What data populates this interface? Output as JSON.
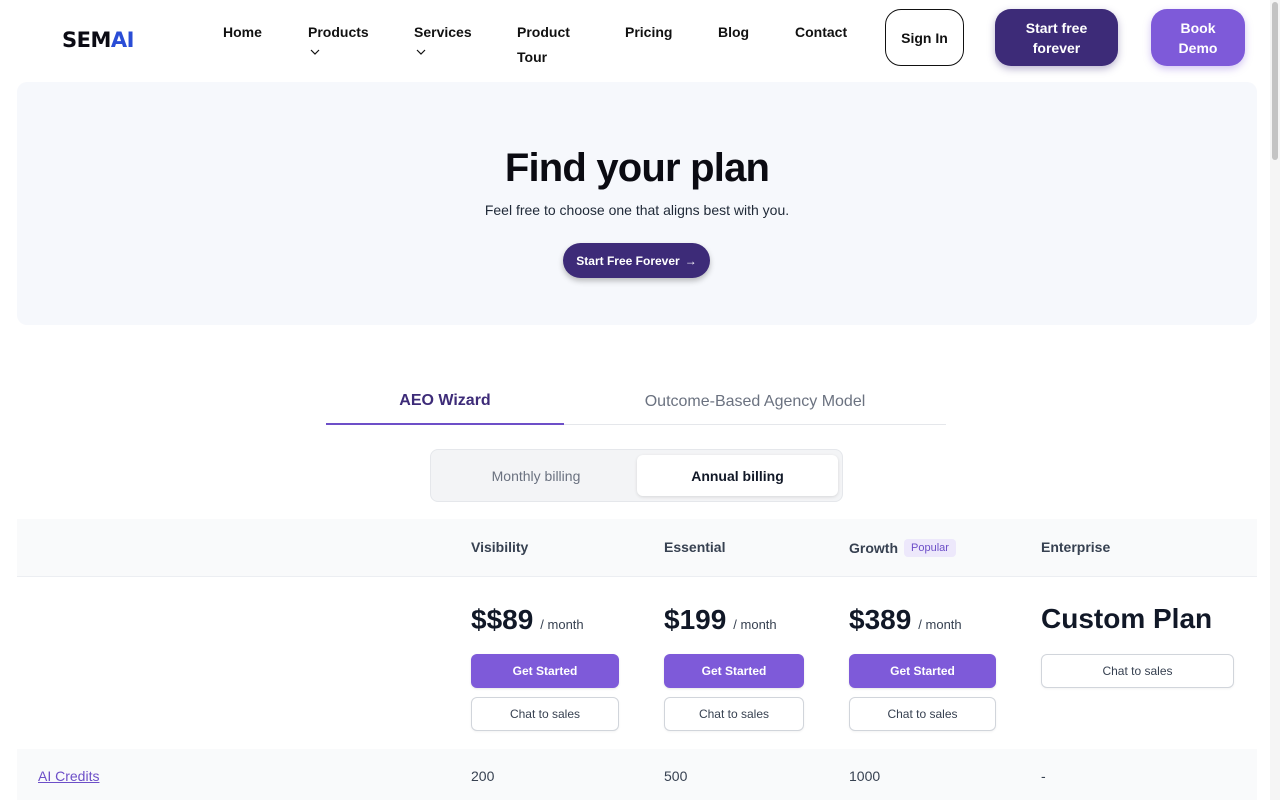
{
  "nav": {
    "logo": {
      "part1": "SEM",
      "part2": "AI"
    },
    "links": {
      "home": "Home",
      "products": "Products",
      "services": "Services",
      "product_tour": "Product Tour",
      "pricing": "Pricing",
      "blog": "Blog",
      "contact": "Contact"
    },
    "sign_in": "Sign In",
    "start_free": "Start free forever",
    "book_demo": "Book Demo"
  },
  "hero": {
    "title": "Find your plan",
    "subtitle": "Feel free to choose one that aligns best with you.",
    "cta": "Start Free Forever",
    "cta_arrow": "→"
  },
  "tabs": [
    {
      "label": "AEO Wizard",
      "active": true
    },
    {
      "label": "Outcome-Based Agency Model",
      "active": false
    }
  ],
  "billing": {
    "monthly": "Monthly billing",
    "annual": "Annual billing",
    "selected": "annual"
  },
  "plans": [
    {
      "name": "Visibility",
      "price": "$$89",
      "period": "/ month",
      "get_started": "Get Started",
      "chat": "Chat to sales"
    },
    {
      "name": "Essential",
      "price": "$199",
      "period": "/ month",
      "get_started": "Get Started",
      "chat": "Chat to sales"
    },
    {
      "name": "Growth",
      "badge": "Popular",
      "price": "$389",
      "period": "/ month",
      "get_started": "Get Started",
      "chat": "Chat to sales"
    },
    {
      "name": "Enterprise",
      "price": "Custom Plan",
      "chat": "Chat to sales"
    }
  ],
  "features": [
    {
      "label": "AI Credits",
      "values": [
        "200",
        "500",
        "1000",
        "-"
      ]
    }
  ],
  "colors": {
    "primary_dark": "#3d2b78",
    "primary": "#7e5ad9",
    "hero_bg": "#f6f8fc"
  }
}
